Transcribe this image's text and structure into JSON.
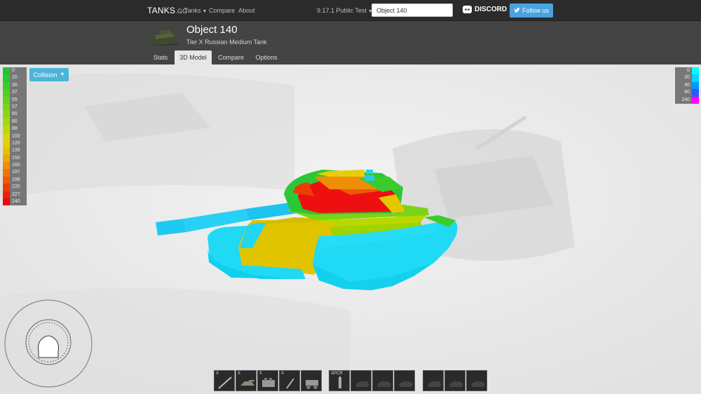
{
  "nav": {
    "brand_main": "TANKS",
    "brand_suffix": ".GG",
    "tanks_label": "Tanks",
    "compare_label": "Compare",
    "about_label": "About",
    "version_label": "9.17.1 Public Test",
    "search_value": "Object 140",
    "discord_label": "DISCORD",
    "follow_label": "Follow us"
  },
  "tank": {
    "name": "Object 140",
    "subtitle": "Tier X Russian Medium Tank"
  },
  "tabs": [
    {
      "label": "Stats"
    },
    {
      "label": "3D Model"
    },
    {
      "label": "Compare"
    },
    {
      "label": "Options"
    }
  ],
  "collision_label": "Collision",
  "armor_legend": [
    {
      "value": "0",
      "color": "#22c33a"
    },
    {
      "value": "20",
      "color": "#2ac834"
    },
    {
      "value": "30",
      "color": "#3ccc2a"
    },
    {
      "value": "37",
      "color": "#52cf22"
    },
    {
      "value": "55",
      "color": "#66d21c"
    },
    {
      "value": "57",
      "color": "#7ad418"
    },
    {
      "value": "65",
      "color": "#8ed614"
    },
    {
      "value": "80",
      "color": "#a4d810"
    },
    {
      "value": "88",
      "color": "#bcd80c"
    },
    {
      "value": "100",
      "color": "#d4d80a"
    },
    {
      "value": "120",
      "color": "#e5d008"
    },
    {
      "value": "135",
      "color": "#eabe08"
    },
    {
      "value": "150",
      "color": "#eca808"
    },
    {
      "value": "160",
      "color": "#ed8e08"
    },
    {
      "value": "187",
      "color": "#ee7408"
    },
    {
      "value": "196",
      "color": "#ee5808"
    },
    {
      "value": "220",
      "color": "#ee3c08"
    },
    {
      "value": "227",
      "color": "#ee2008"
    },
    {
      "value": "240",
      "color": "#ee0808"
    }
  ],
  "spaced_legend": [
    {
      "value": "0",
      "color": "#00ffff"
    },
    {
      "value": "20",
      "color": "#00d6ff"
    },
    {
      "value": "40",
      "color": "#0098ff"
    },
    {
      "value": "60",
      "color": "#2a5aff"
    },
    {
      "value": "240",
      "color": "#ff00ff"
    }
  ],
  "toolbar": {
    "group1": [
      {
        "label": "X",
        "icon": "gun-icon"
      },
      {
        "label": "X",
        "icon": "turret-icon"
      },
      {
        "label": "X",
        "icon": "engine-icon"
      },
      {
        "label": "X",
        "icon": "radio-icon"
      },
      {
        "label": "",
        "icon": "suspension-icon"
      }
    ],
    "group2": [
      {
        "label": "APCR",
        "icon": "shell-icon"
      },
      {
        "label": "",
        "icon": "shell-slot-icon"
      },
      {
        "label": "",
        "icon": "shell-slot-icon"
      },
      {
        "label": "",
        "icon": "shell-slot-icon"
      }
    ],
    "group3": [
      {
        "label": "",
        "icon": "equipment-slot-icon"
      },
      {
        "label": "",
        "icon": "equipment-slot-icon"
      },
      {
        "label": "",
        "icon": "equipment-slot-icon"
      }
    ]
  }
}
